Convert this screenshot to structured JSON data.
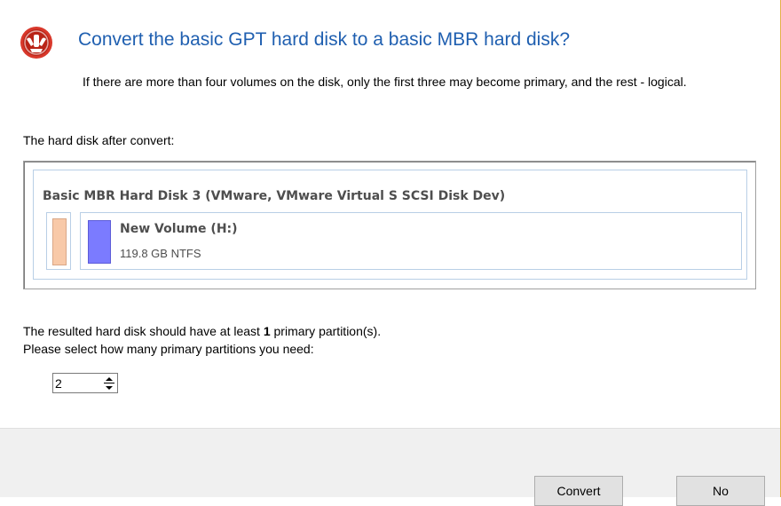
{
  "dialog": {
    "title": "Convert the basic GPT hard disk to a basic MBR hard disk?",
    "description": "If there are more than four volumes on the disk, only the first three may become primary, and the rest - logical.",
    "after_label": "The hard disk after convert:"
  },
  "disk": {
    "title": "Basic MBR Hard Disk 3 (VMware, VMware Virtual S SCSI Disk Dev)",
    "partitions": [
      {
        "type": "reserved",
        "color": "#f8c9a8"
      },
      {
        "name": "New Volume (H:)",
        "info": "119.8 GB NTFS",
        "color": "#7b7bff"
      }
    ]
  },
  "requirement": {
    "prefix": "The resulted hard disk should have at least ",
    "count": "1",
    "suffix": " primary partition(s).",
    "prompt": "Please select how many primary partitions you need:"
  },
  "spinner": {
    "value": "2"
  },
  "buttons": {
    "convert": "Convert",
    "no": "No"
  },
  "colors": {
    "title": "#1f5fb0",
    "footer_bg": "#f0f0f0",
    "border_accent": "#e3b04a"
  }
}
